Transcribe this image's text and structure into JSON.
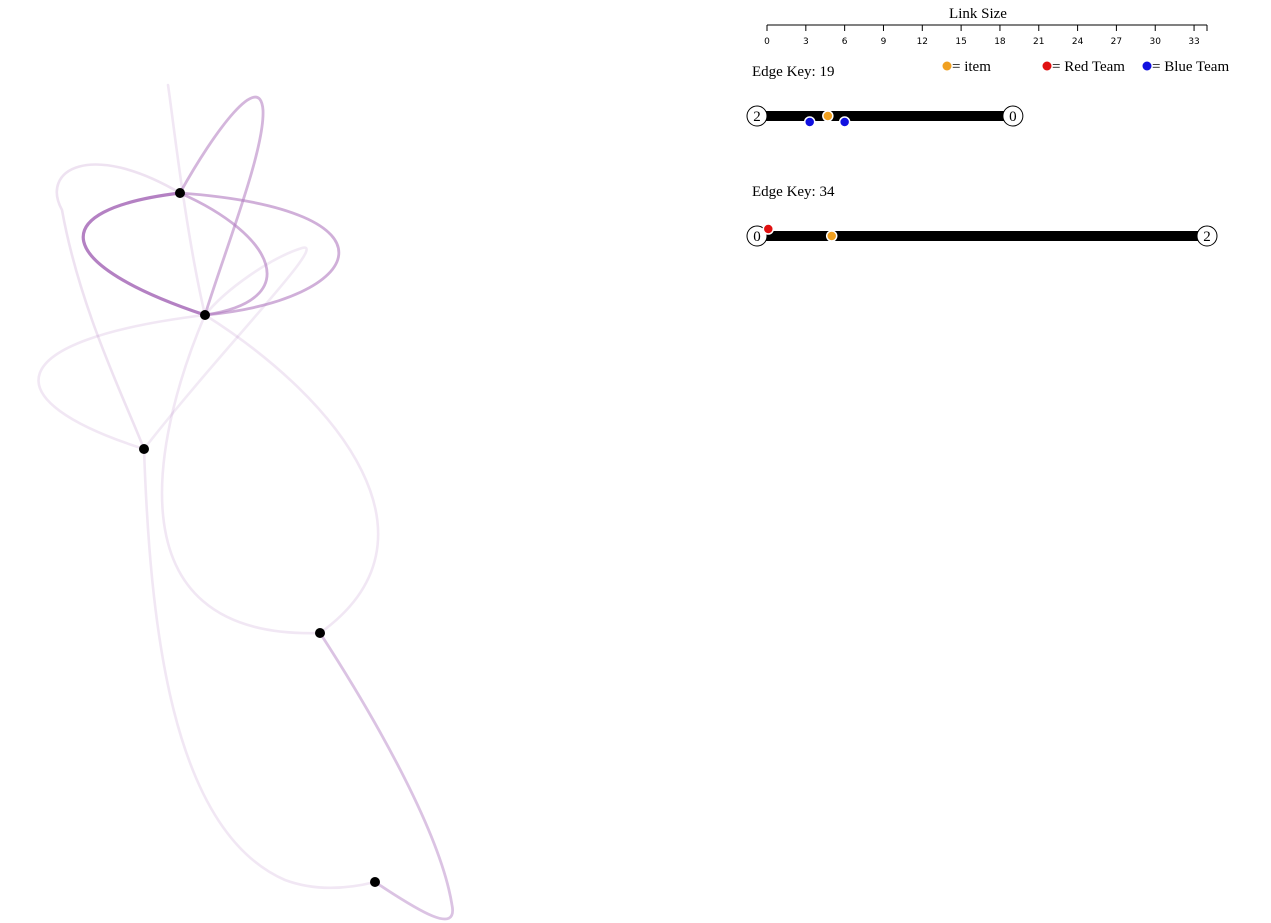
{
  "scale": {
    "title": "Link Size",
    "ticks": [
      "0",
      "3",
      "6",
      "9",
      "12",
      "15",
      "18",
      "21",
      "24",
      "27",
      "30",
      "33"
    ],
    "max": 34
  },
  "legend": [
    {
      "label": "= item",
      "color": "#f0a020"
    },
    {
      "label": "= Red Team",
      "color": "#e01010"
    },
    {
      "label": "= Blue Team",
      "color": "#1010e0"
    }
  ],
  "edges": [
    {
      "title": "Edge Key: 19",
      "length": 19,
      "start_label": "2",
      "end_label": "0",
      "markers": [
        {
          "pos": 4.7,
          "type": "item",
          "side": "on"
        },
        {
          "pos": 3.3,
          "type": "blue",
          "side": "below"
        },
        {
          "pos": 6.0,
          "type": "blue",
          "side": "below"
        }
      ]
    },
    {
      "title": "Edge Key: 34",
      "length": 34,
      "start_label": "0",
      "end_label": "2",
      "markers": [
        {
          "pos": 0.1,
          "type": "red",
          "side": "above"
        },
        {
          "pos": 5.0,
          "type": "item",
          "side": "on"
        }
      ]
    }
  ],
  "graph": {
    "edge_color": "#b07ac0",
    "node_color": "#000000",
    "nodes": [
      "n-a",
      "n-b",
      "n-c",
      "n-d",
      "n-e"
    ]
  }
}
